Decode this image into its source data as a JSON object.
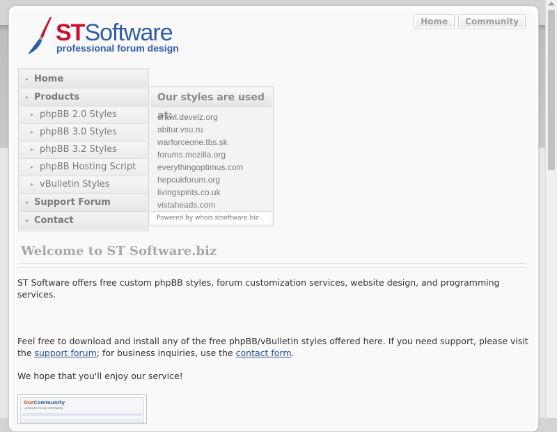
{
  "logo": {
    "title_st": "ST",
    "title_software": "Software",
    "tagline": "professional forum design"
  },
  "topnav": [
    {
      "label": "Home"
    },
    {
      "label": "Community"
    }
  ],
  "sidebar": {
    "items": [
      {
        "label": "Home",
        "level": "top"
      },
      {
        "label": "Products",
        "level": "top"
      },
      {
        "label": "phpBB 2.0 Styles",
        "level": "sub"
      },
      {
        "label": "phpBB 3.0 Styles",
        "level": "sub"
      },
      {
        "label": "phpBB 3.2 Styles",
        "level": "sub"
      },
      {
        "label": "phpBB Hosting Script",
        "level": "sub"
      },
      {
        "label": "vBulletin Styles",
        "level": "sub"
      },
      {
        "label": "Support Forum",
        "level": "top"
      },
      {
        "label": "Contact",
        "level": "top"
      }
    ]
  },
  "used_box": {
    "heading": "Our styles are used at:",
    "sites": [
      "crawl.develz.org",
      "abitur.vsu.ru",
      "warforceone.tbs.sk",
      "forums.mozilla.org",
      "everythingoptimus.com",
      "hepcukforum.org",
      "livingspirits.co.uk",
      "vistaheads.com"
    ],
    "footer": "Powered by whois.stsoftware.biz"
  },
  "content": {
    "welcome": "Welcome to ST Software.biz",
    "intro": "ST Software offers free custom phpBB styles, forum customization services, website design, and programming services.",
    "p2_part1": "Feel free to download and install any of the free phpBB/vBulletin styles offered here. If you need support, please visit the ",
    "p2_link1": "support forum",
    "p2_part2": "; for business inquiries, use the ",
    "p2_link2": "contact form",
    "p2_part3": ".",
    "closing": "We hope that you'll enjoy our service!"
  },
  "thumbnail": {
    "logo_o": "Our",
    "logo_rest": "Community",
    "subtitle": "welcome to our community"
  }
}
